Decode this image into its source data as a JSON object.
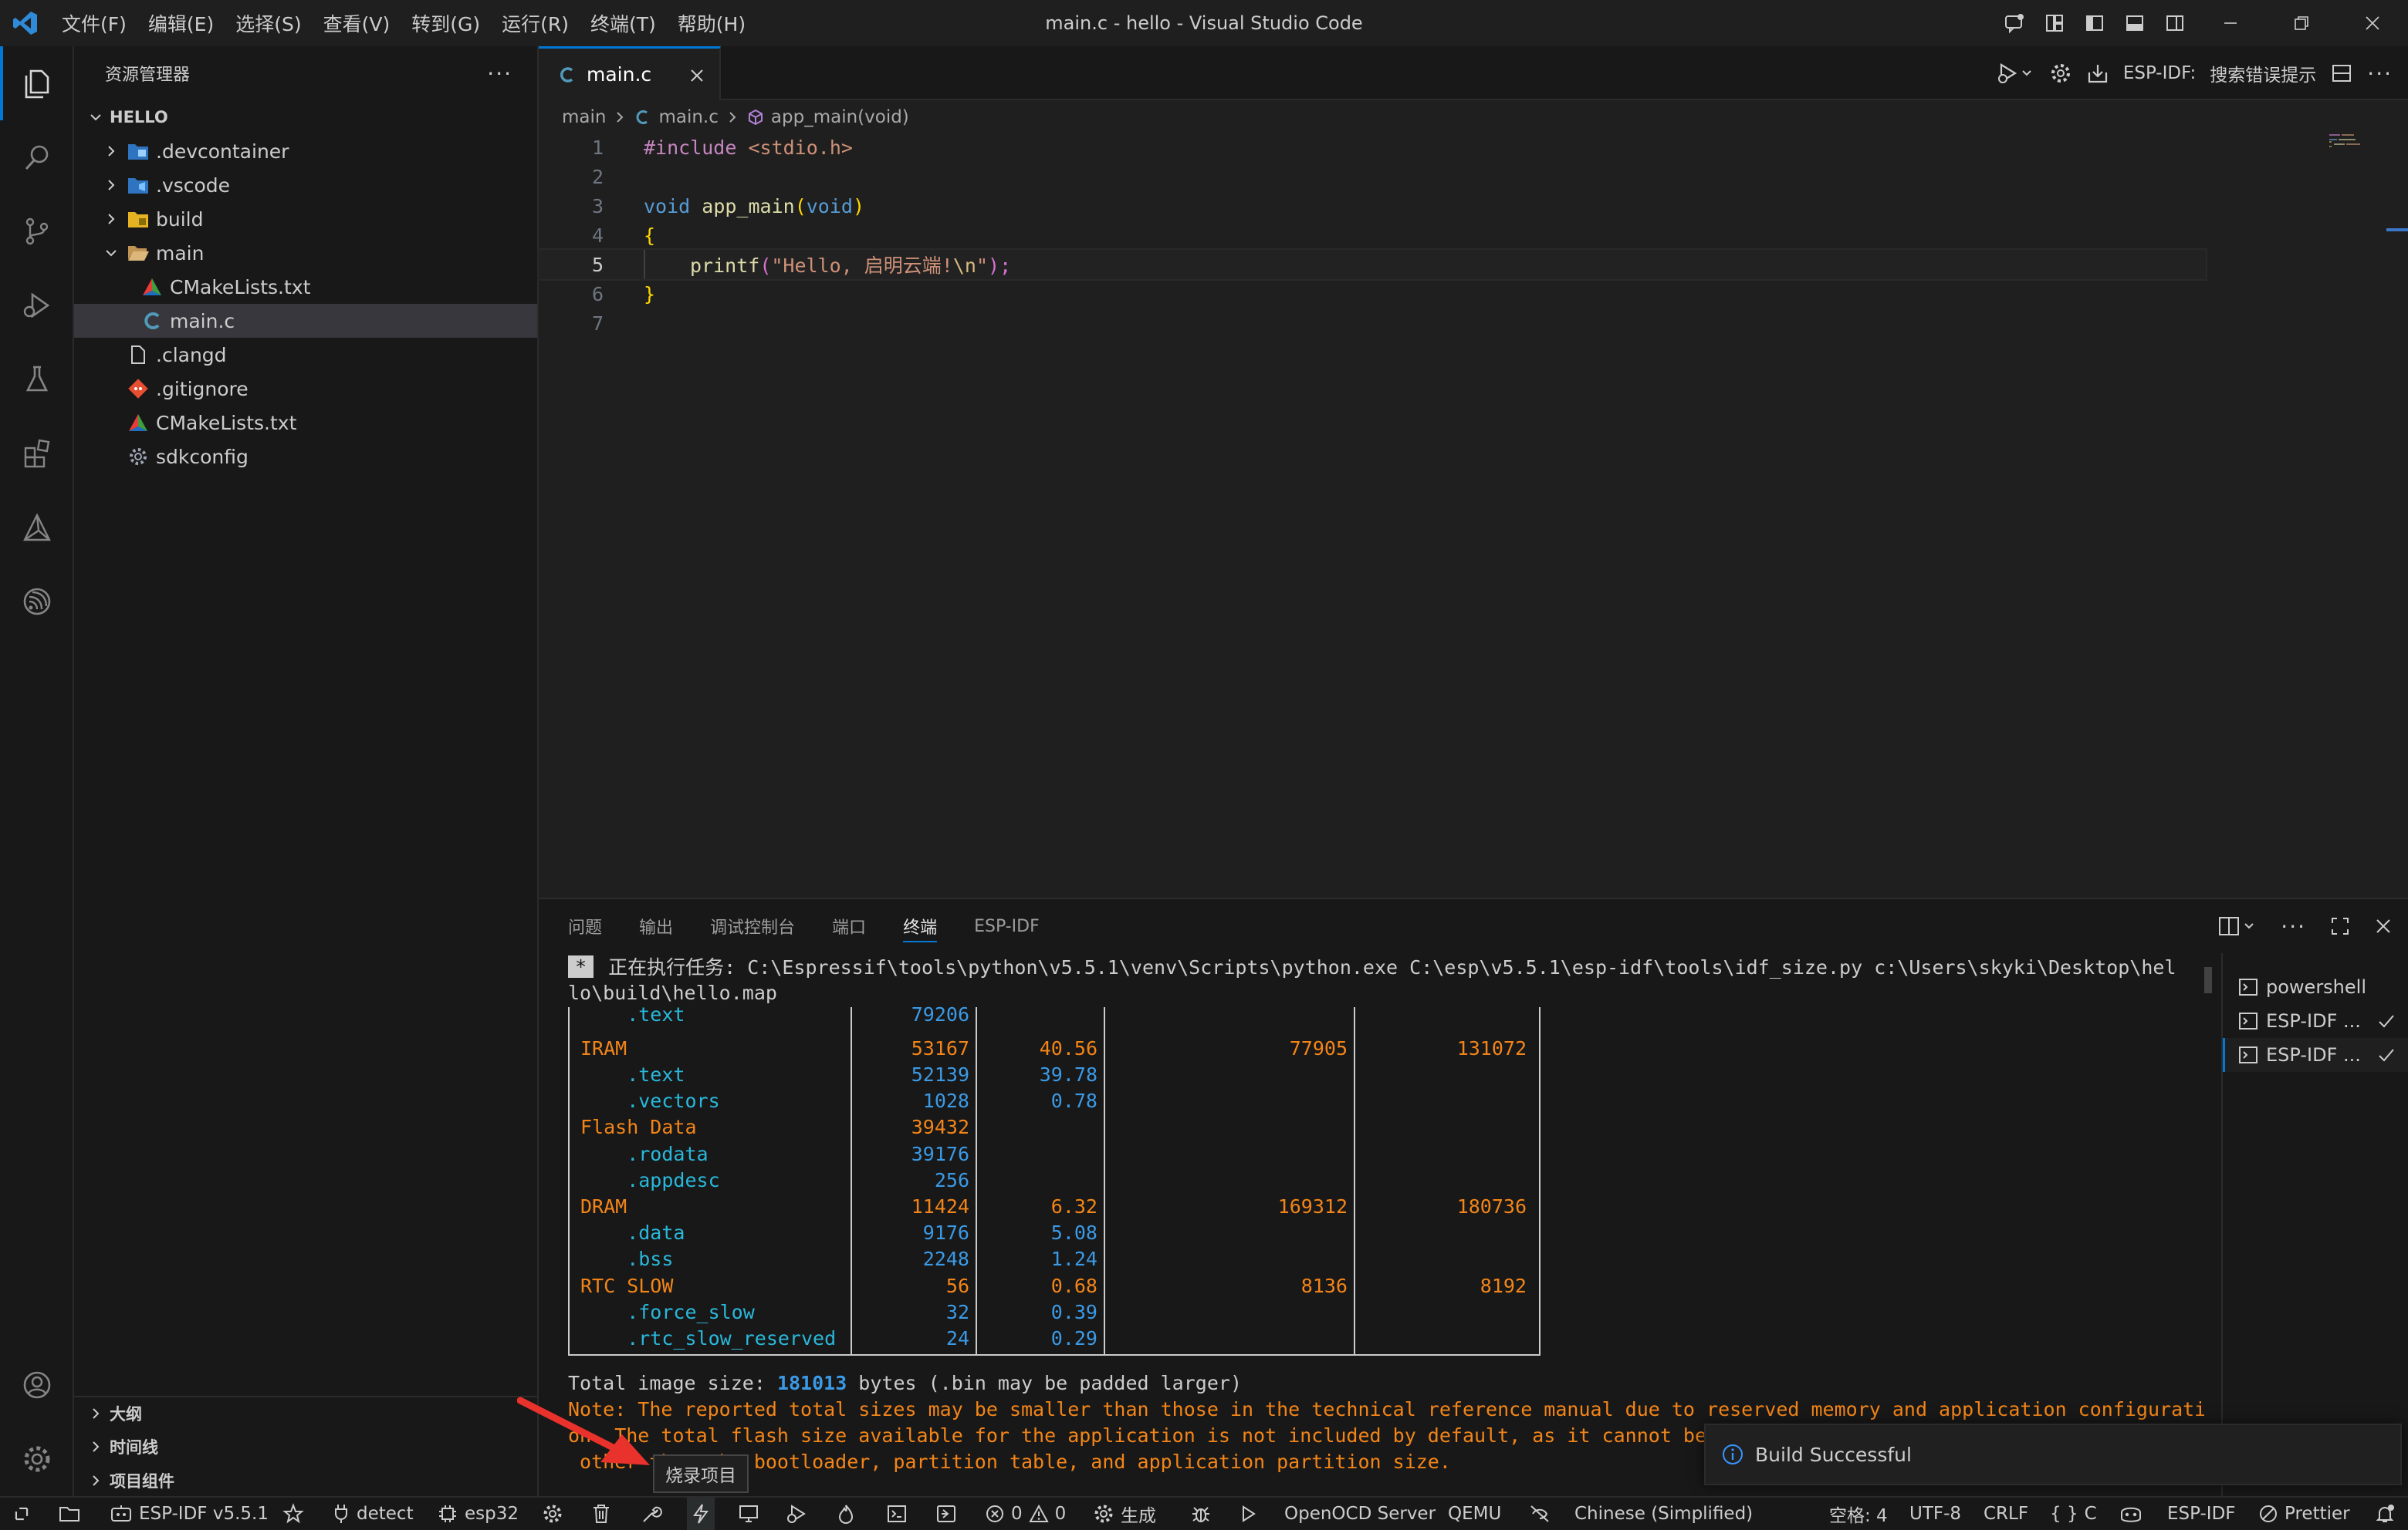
{
  "window": {
    "title": "main.c - hello - Visual Studio Code"
  },
  "menu": [
    "文件(F)",
    "编辑(E)",
    "选择(S)",
    "查看(V)",
    "转到(G)",
    "运行(R)",
    "终端(T)",
    "帮助(H)"
  ],
  "sidebar": {
    "title": "资源管理器",
    "more": "···",
    "root": "HELLO",
    "tree": [
      {
        "label": ".devcontainer",
        "kind": "folder",
        "icon": "devcontainer-folder-icon"
      },
      {
        "label": ".vscode",
        "kind": "folder",
        "icon": "vscode-folder-icon"
      },
      {
        "label": "build",
        "kind": "folder",
        "icon": "build-folder-icon"
      },
      {
        "label": "main",
        "kind": "folder-open",
        "icon": "folder-open-icon"
      },
      {
        "label": "CMakeLists.txt",
        "kind": "file",
        "icon": "cmake-icon"
      },
      {
        "label": "main.c",
        "kind": "file",
        "icon": "c-file-icon"
      },
      {
        "label": ".clangd",
        "kind": "file",
        "icon": "file-icon"
      },
      {
        "label": ".gitignore",
        "kind": "file",
        "icon": "git-icon"
      },
      {
        "label": "CMakeLists.txt",
        "kind": "file",
        "icon": "cmake-icon"
      },
      {
        "label": "sdkconfig",
        "kind": "file",
        "icon": "gear-file-icon"
      }
    ],
    "bottom_sections": [
      "大纲",
      "时间线",
      "项目组件"
    ]
  },
  "editor": {
    "tab": {
      "icon": "C",
      "label": "main.c"
    },
    "actions": {
      "esp_idf": "ESP-IDF:",
      "search": "搜索错误提示"
    },
    "breadcrumbs": {
      "folder": "main",
      "file": "main.c",
      "symbol": "app_main(void)"
    },
    "lines": [
      "1",
      "2",
      "3",
      "4",
      "5",
      "6",
      "7"
    ],
    "code": {
      "l1_directive": "#include",
      "l1_header": " <stdio.h>",
      "l3_type": "void",
      "l3_fn": " app_main",
      "l3_paren": "(",
      "l3_arg": "void",
      "l3_close": ")",
      "l4": "{",
      "l5_fn": "printf",
      "l5_open": "(",
      "l5_str": "\"Hello, 启明云端!",
      "l5_esc": "\\n",
      "l5_end": "\"",
      "l5_close": ");",
      "l6": "}"
    }
  },
  "panel": {
    "tabs": [
      "问题",
      "输出",
      "调试控制台",
      "端口",
      "终端",
      "ESP-IDF"
    ],
    "active_tab": "终端",
    "terminals": [
      {
        "label": "powershell",
        "check": false
      },
      {
        "label": "ESP-IDF ...",
        "check": true
      },
      {
        "label": "ESP-IDF ...",
        "check": true
      }
    ],
    "task_badge": "*",
    "task_line1": " 正在执行任务: C:\\Espressif\\tools\\python\\v5.5.1\\venv\\Scripts\\python.exe C:\\esp\\v5.5.1\\esp-idf\\tools\\idf_size.py c:\\Users\\skyki\\Desktop\\hel",
    "task_line2": "lo\\build\\hello.map",
    "table_rows": [
      {
        "name": "    .text",
        "used": "79206",
        "pct": "",
        "remain": "",
        "total": "",
        "top": true
      },
      {
        "name": "IRAM",
        "used": "53167",
        "pct": "40.56",
        "remain": "77905",
        "total": "131072",
        "top": true
      },
      {
        "name": "    .text",
        "used": "52139",
        "pct": "39.78",
        "remain": "",
        "total": "",
        "top": false
      },
      {
        "name": "    .vectors",
        "used": "1028",
        "pct": "0.78",
        "remain": "",
        "total": "",
        "top": false
      },
      {
        "name": "Flash Data",
        "used": "39432",
        "pct": "",
        "remain": "",
        "total": "",
        "top": true
      },
      {
        "name": "    .rodata",
        "used": "39176",
        "pct": "",
        "remain": "",
        "total": "",
        "top": false
      },
      {
        "name": "    .appdesc",
        "used": "256",
        "pct": "",
        "remain": "",
        "total": "",
        "top": false
      },
      {
        "name": "DRAM",
        "used": "11424",
        "pct": "6.32",
        "remain": "169312",
        "total": "180736",
        "top": true
      },
      {
        "name": "    .data",
        "used": "9176",
        "pct": "5.08",
        "remain": "",
        "total": "",
        "top": false
      },
      {
        "name": "    .bss",
        "used": "2248",
        "pct": "1.24",
        "remain": "",
        "total": "",
        "top": false
      },
      {
        "name": "RTC SLOW",
        "used": "56",
        "pct": "0.68",
        "remain": "8136",
        "total": "8192",
        "top": true
      },
      {
        "name": "    .force_slow",
        "used": "32",
        "pct": "0.39",
        "remain": "",
        "total": "",
        "top": false
      },
      {
        "name": "    .rtc_slow_reserved",
        "used": "24",
        "pct": "0.29",
        "remain": "",
        "total": "",
        "top": false
      }
    ],
    "total_prefix": "Total image size: ",
    "total_value": "181013",
    "total_suffix": " bytes (.bin may be padded larger)",
    "note1": "Note: The reported total sizes may be smaller than those in the technical reference manual due to reserved memory and application configurati",
    "note2": "on. The total flash size available for the application is not included by default, as it cannot be",
    "note3": " other than the bootloader, partition table, and application partition size."
  },
  "toast": {
    "text": "Build Successful"
  },
  "tooltip": {
    "text": "烧录项目"
  },
  "statusbar": {
    "esp_idf_version": "ESP-IDF v5.5.1",
    "detect": "detect",
    "target": "esp32",
    "problems": "0",
    "warnings": "0",
    "build": "生成",
    "openocd": "OpenOCD Server",
    "qemu": "QEMU",
    "language": "Chinese (Simplified)",
    "spaces": "空格: 4",
    "encoding": "UTF-8",
    "eol": "CRLF",
    "lang_mode": "C",
    "esp_idf": "ESP-IDF",
    "prettier": "Prettier"
  },
  "colors": {
    "accent": "#0078d4",
    "terminal_orange": "#f38518",
    "terminal_blue": "#3b9ae6",
    "info_blue": "#3794ff"
  }
}
